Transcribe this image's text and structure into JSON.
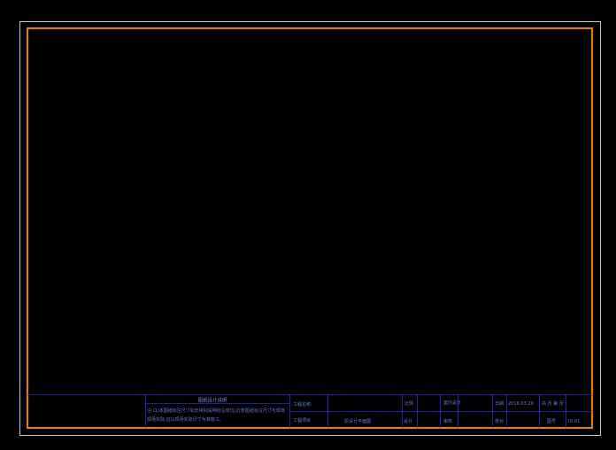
{
  "drawing": {
    "colors": {
      "background": "#000000",
      "outer_border": "#c8c8c8",
      "inner_border": "#e07a1f",
      "title_block_lines": "#2b2bd6",
      "title_block_text": "#6a7bd6"
    },
    "notes": {
      "heading": "图纸设计说明",
      "line1": "注:(1)本图纸标注尺寸如无特别说明标注单位(2)若图纸标注尺寸与现场",
      "line2": "现场实际,应以现场实际尺寸为准施工。"
    },
    "title_block": {
      "project_name_label": "工程名称:",
      "project_label": "工程项目",
      "drawing_name": "原设计平面图",
      "scale_label": "比例",
      "designer_label": "设计",
      "mid_label": "审核",
      "interior_label": "室内设计",
      "check_label": "审核",
      "date_label": "日期",
      "date_value": "2016.03.20",
      "proofread_label": "校对",
      "sheet_label": "共 页 第 页",
      "drawing_no_label": "图号",
      "drawing_no_value": "ID-01"
    }
  }
}
